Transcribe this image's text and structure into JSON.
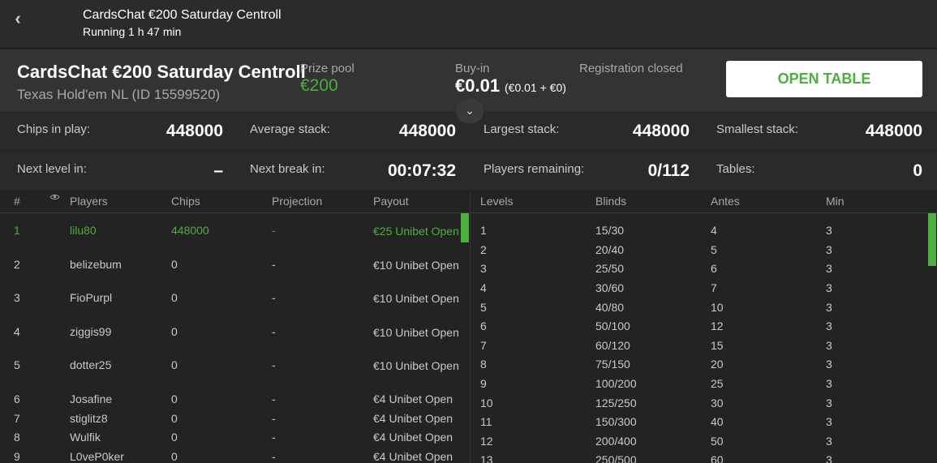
{
  "topbar": {
    "title": "CardsChat €200 Saturday Centroll",
    "status": "Running 1 h 47 min"
  },
  "header": {
    "title": "CardsChat €200 Saturday Centroll",
    "game": "Texas Hold'em NL (ID 15599520)",
    "prize_label": "Prize pool",
    "prize_value": "€200",
    "buyin_label": "Buy-in",
    "buyin_value": "€0.01",
    "buyin_breakdown": "(€0.01 + €0)",
    "registration": "Registration closed",
    "open_table": "OPEN TABLE"
  },
  "stats": [
    {
      "label": "Chips in play:",
      "value": "448000"
    },
    {
      "label": "Average stack:",
      "value": "448000"
    },
    {
      "label": "Largest stack:",
      "value": "448000"
    },
    {
      "label": "Smallest stack:",
      "value": "448000"
    },
    {
      "label": "Next level in:",
      "value": "–"
    },
    {
      "label": "Next break in:",
      "value": "00:07:32"
    },
    {
      "label": "Players remaining:",
      "value": "0/112"
    },
    {
      "label": "Tables:",
      "value": "0"
    }
  ],
  "players": {
    "headers": {
      "rank": "#",
      "players": "Players",
      "chips": "Chips",
      "projection": "Projection",
      "payout": "Payout"
    },
    "rows": [
      {
        "rank": "1",
        "name": "lilu80",
        "chips": "448000",
        "projection": "-",
        "payout": "€25 Unibet Open"
      },
      {
        "rank": "2",
        "name": "belizebum",
        "chips": "0",
        "projection": "-",
        "payout": "€10 Unibet Open"
      },
      {
        "rank": "3",
        "name": "FioPurpl",
        "chips": "0",
        "projection": "-",
        "payout": "€10 Unibet Open"
      },
      {
        "rank": "4",
        "name": "ziggis99",
        "chips": "0",
        "projection": "-",
        "payout": "€10 Unibet Open"
      },
      {
        "rank": "5",
        "name": "dotter25",
        "chips": "0",
        "projection": "-",
        "payout": "€10 Unibet Open"
      },
      {
        "rank": "6",
        "name": "Josafine",
        "chips": "0",
        "projection": "-",
        "payout": "€4 Unibet Open"
      },
      {
        "rank": "7",
        "name": "stiglitz8",
        "chips": "0",
        "projection": "-",
        "payout": "€4 Unibet Open"
      },
      {
        "rank": "8",
        "name": "Wulfik",
        "chips": "0",
        "projection": "-",
        "payout": "€4 Unibet Open"
      },
      {
        "rank": "9",
        "name": "L0veP0ker",
        "chips": "0",
        "projection": "-",
        "payout": "€4 Unibet Open"
      }
    ]
  },
  "levels": {
    "headers": {
      "levels": "Levels",
      "blinds": "Blinds",
      "antes": "Antes",
      "min": "Min"
    },
    "rows": [
      {
        "level": "1",
        "blinds": "15/30",
        "antes": "4",
        "min": "3"
      },
      {
        "level": "2",
        "blinds": "20/40",
        "antes": "5",
        "min": "3"
      },
      {
        "level": "3",
        "blinds": "25/50",
        "antes": "6",
        "min": "3"
      },
      {
        "level": "4",
        "blinds": "30/60",
        "antes": "7",
        "min": "3"
      },
      {
        "level": "5",
        "blinds": "40/80",
        "antes": "10",
        "min": "3"
      },
      {
        "level": "6",
        "blinds": "50/100",
        "antes": "12",
        "min": "3"
      },
      {
        "level": "7",
        "blinds": "60/120",
        "antes": "15",
        "min": "3"
      },
      {
        "level": "8",
        "blinds": "75/150",
        "antes": "20",
        "min": "3"
      },
      {
        "level": "9",
        "blinds": "100/200",
        "antes": "25",
        "min": "3"
      },
      {
        "level": "10",
        "blinds": "125/250",
        "antes": "30",
        "min": "3"
      },
      {
        "level": "11",
        "blinds": "150/300",
        "antes": "40",
        "min": "3"
      },
      {
        "level": "12",
        "blinds": "200/400",
        "antes": "50",
        "min": "3"
      },
      {
        "level": "13",
        "blinds": "250/500",
        "antes": "60",
        "min": "3"
      }
    ]
  },
  "colors": {
    "accent": "#4cae3c",
    "background": "#222222",
    "header_bg": "#333333"
  }
}
